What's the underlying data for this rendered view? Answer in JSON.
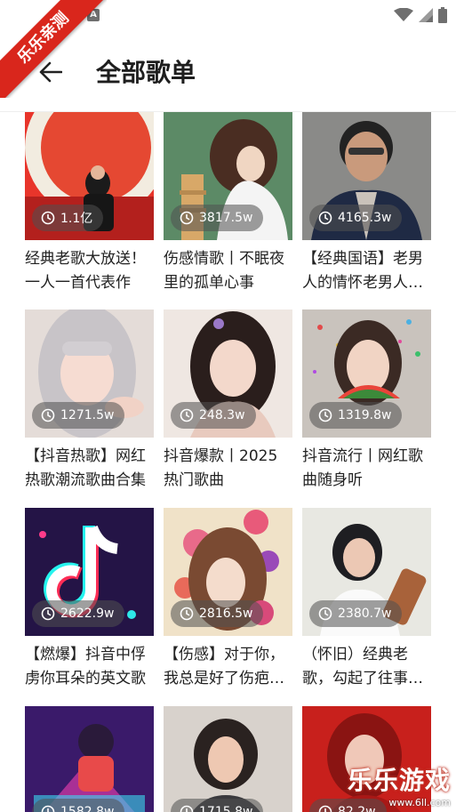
{
  "status_bar": {
    "badge": "A"
  },
  "header": {
    "title": "全部歌单"
  },
  "ribbon": "乐乐亲测",
  "watermark": {
    "main": "乐乐游戏",
    "sub": "www.6ll.com"
  },
  "playlists": [
    {
      "plays": "1.1亿",
      "title": "经典老歌大放送！一人一首代表作"
    },
    {
      "plays": "3817.5w",
      "title": "伤感情歌丨不眠夜里的孤单心事"
    },
    {
      "plays": "4165.3w",
      "title": "【经典国语】老男人的情怀老男人的歌"
    },
    {
      "plays": "1271.5w",
      "title": "【抖音热歌】网红热歌潮流歌曲合集"
    },
    {
      "plays": "248.3w",
      "title": "抖音爆款丨2025热门歌曲"
    },
    {
      "plays": "1319.8w",
      "title": "抖音流行丨网红歌曲随身听"
    },
    {
      "plays": "2622.9w",
      "title": "【燃爆】抖音中俘虏你耳朵的英文歌"
    },
    {
      "plays": "2816.5w",
      "title": "【伤感】对于你，我总是好了伤疤忘了疼"
    },
    {
      "plays": "2380.7w",
      "title": "（怀旧）经典老歌，勾起了往事的回忆"
    },
    {
      "plays": "1582.8w",
      "title": ""
    },
    {
      "plays": "1715.8w",
      "title": ""
    },
    {
      "plays": "82.2w",
      "title": ""
    }
  ]
}
